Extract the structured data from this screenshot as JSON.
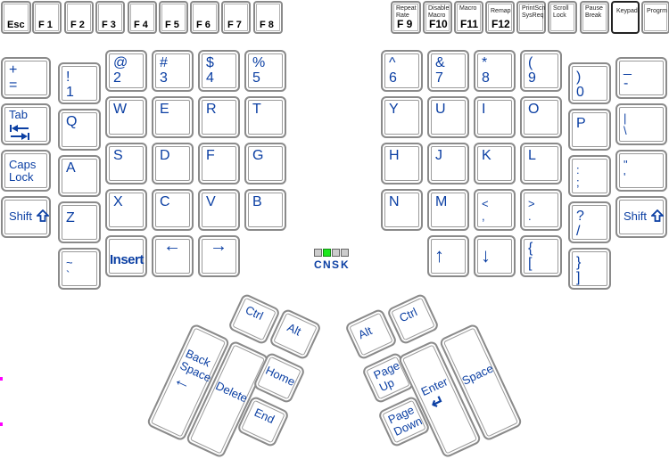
{
  "function_row_left": [
    {
      "label": "Esc"
    },
    {
      "label": "F 1"
    },
    {
      "label": "F 2"
    },
    {
      "label": "F 3"
    },
    {
      "label": "F 4"
    },
    {
      "label": "F 5"
    },
    {
      "label": "F 6"
    },
    {
      "label": "F 7"
    },
    {
      "label": "F 8"
    }
  ],
  "function_row_right": [
    {
      "caption": "Repeat\nRate",
      "label": "F 9"
    },
    {
      "caption": "Disable\nMacro",
      "label": "F10"
    },
    {
      "caption": "Macro",
      "label": "F11"
    },
    {
      "caption": "Remap",
      "label": "F12"
    },
    {
      "caption": "PrintScn\nSysReq",
      "label": ""
    },
    {
      "caption": "Scroll\nLock",
      "label": ""
    },
    {
      "caption": "Pause\nBreak",
      "label": ""
    },
    {
      "caption": "Keypad",
      "label": "",
      "active": true
    },
    {
      "caption": "Progrm",
      "label": ""
    }
  ],
  "left_keys": {
    "plus_equal": "+\n=",
    "tab": "Tab",
    "caps_lock": "Caps\nLock",
    "shift": "Shift",
    "num1": "!\n1",
    "q": "Q",
    "a": "A",
    "z": "Z",
    "tilde": "~\n`",
    "num2": "@\n2",
    "num3": "#\n3",
    "num4": "$\n4",
    "num5": "%\n5",
    "w": "W",
    "e": "E",
    "r": "R",
    "t": "T",
    "s": "S",
    "d": "D",
    "f": "F",
    "g": "G",
    "x": "X",
    "c": "C",
    "v": "V",
    "b": "B",
    "insert": "Insert",
    "left_arrow": "←",
    "right_arrow": "→"
  },
  "right_keys": {
    "num6": "^\n6",
    "num7": "&\n7",
    "num8": "*\n8",
    "num9": "(\n9",
    "num0": ")\n0",
    "minus": "_\n-",
    "y": "Y",
    "u": "U",
    "i": "I",
    "o": "O",
    "p": "P",
    "backslash": "|\n\\",
    "h": "H",
    "j": "J",
    "k": "K",
    "l": "L",
    "semicolon": ":\n;",
    "quote": "\"\n'",
    "n": "N",
    "m": "M",
    "comma": "<\n,",
    "period": ">\n.",
    "slash": "?\n/",
    "shift": "Shift",
    "up_arrow": "↑",
    "down_arrow": "↓",
    "lbracket": "{\n[",
    "rbracket": "}\n]"
  },
  "indicators": {
    "labels": [
      "C",
      "N",
      "S",
      "K"
    ],
    "states": [
      false,
      true,
      false,
      false
    ],
    "on_color": "#1ee81e",
    "off_color": "#cccccc"
  },
  "left_thumb": {
    "ctrl": "Ctrl",
    "alt": "Alt",
    "backspace": "Back\nSpace",
    "delete": "Delete",
    "home": "Home",
    "end": "End"
  },
  "right_thumb": {
    "alt": "Alt",
    "ctrl": "Ctrl",
    "page_up": "Page\nUp",
    "page_down": "Page\nDown",
    "enter": "Enter",
    "space": "Space"
  },
  "colors": {
    "label": "#0b3fa3",
    "key_border": "#8a8a8a"
  }
}
